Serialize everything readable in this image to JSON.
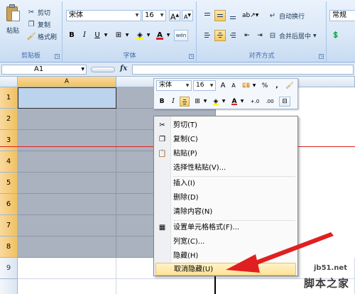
{
  "ribbon": {
    "clipboard": {
      "paste": "粘贴",
      "cut": "剪切",
      "copy": "复制",
      "format_painter": "格式刷",
      "label": "剪贴板"
    },
    "font": {
      "name": "宋体",
      "size": "16",
      "grow": "A",
      "shrink": "A",
      "bold": "B",
      "italic": "I",
      "underline": "U",
      "font_color": "A",
      "phonetic": "wén",
      "label": "字体"
    },
    "alignment": {
      "wrap_text": "自动换行",
      "merge_center": "合并后居中",
      "label": "对齐方式"
    },
    "number": {
      "format": "常规"
    }
  },
  "formula_bar": {
    "name_box": "A1",
    "fx": "fx",
    "formula": ""
  },
  "grid": {
    "columns": [
      "A",
      ""
    ],
    "rows": [
      "1",
      "2",
      "3",
      "4",
      "5",
      "6",
      "7",
      "8",
      "9",
      ""
    ]
  },
  "mini_toolbar": {
    "font_name": "宋体",
    "font_size": "16",
    "grow": "A",
    "shrink": "A",
    "percent": "%",
    "comma": ",",
    "bold": "B",
    "italic": "I",
    "font_color": "A",
    "inc_decimal": "+.0",
    "dec_decimal": ".00"
  },
  "context_menu": {
    "items": [
      {
        "label": "剪切(T)",
        "icon": "scissors-icon"
      },
      {
        "label": "复制(C)",
        "icon": "copy-icon"
      },
      {
        "label": "粘贴(P)",
        "icon": "paste-icon"
      },
      {
        "label": "选择性粘贴(V)...",
        "icon": ""
      },
      {
        "label": "插入(I)",
        "icon": ""
      },
      {
        "label": "删除(D)",
        "icon": ""
      },
      {
        "label": "清除内容(N)",
        "icon": ""
      },
      {
        "label": "设置单元格格式(F)...",
        "icon": "format-cells-icon"
      },
      {
        "label": "列宽(C)...",
        "icon": ""
      },
      {
        "label": "隐藏(H)",
        "icon": ""
      },
      {
        "label": "取消隐藏(U)",
        "icon": ""
      }
    ]
  },
  "watermark": {
    "site": "jb51.net",
    "name": "脚本之家"
  },
  "colors": {
    "selection": "#aab2bf",
    "highlight": "#fde39a",
    "annotation": "#e02020"
  }
}
